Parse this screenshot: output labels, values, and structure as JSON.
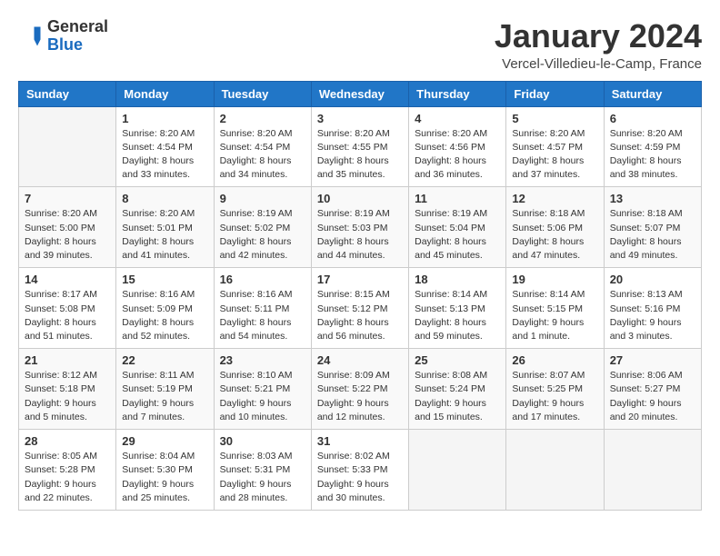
{
  "header": {
    "logo_general": "General",
    "logo_blue": "Blue",
    "month_title": "January 2024",
    "location": "Vercel-Villedieu-le-Camp, France"
  },
  "days_of_week": [
    "Sunday",
    "Monday",
    "Tuesday",
    "Wednesday",
    "Thursday",
    "Friday",
    "Saturday"
  ],
  "weeks": [
    [
      {
        "day": "",
        "detail": ""
      },
      {
        "day": "1",
        "detail": "Sunrise: 8:20 AM\nSunset: 4:54 PM\nDaylight: 8 hours\nand 33 minutes."
      },
      {
        "day": "2",
        "detail": "Sunrise: 8:20 AM\nSunset: 4:54 PM\nDaylight: 8 hours\nand 34 minutes."
      },
      {
        "day": "3",
        "detail": "Sunrise: 8:20 AM\nSunset: 4:55 PM\nDaylight: 8 hours\nand 35 minutes."
      },
      {
        "day": "4",
        "detail": "Sunrise: 8:20 AM\nSunset: 4:56 PM\nDaylight: 8 hours\nand 36 minutes."
      },
      {
        "day": "5",
        "detail": "Sunrise: 8:20 AM\nSunset: 4:57 PM\nDaylight: 8 hours\nand 37 minutes."
      },
      {
        "day": "6",
        "detail": "Sunrise: 8:20 AM\nSunset: 4:59 PM\nDaylight: 8 hours\nand 38 minutes."
      }
    ],
    [
      {
        "day": "7",
        "detail": "Sunrise: 8:20 AM\nSunset: 5:00 PM\nDaylight: 8 hours\nand 39 minutes."
      },
      {
        "day": "8",
        "detail": "Sunrise: 8:20 AM\nSunset: 5:01 PM\nDaylight: 8 hours\nand 41 minutes."
      },
      {
        "day": "9",
        "detail": "Sunrise: 8:19 AM\nSunset: 5:02 PM\nDaylight: 8 hours\nand 42 minutes."
      },
      {
        "day": "10",
        "detail": "Sunrise: 8:19 AM\nSunset: 5:03 PM\nDaylight: 8 hours\nand 44 minutes."
      },
      {
        "day": "11",
        "detail": "Sunrise: 8:19 AM\nSunset: 5:04 PM\nDaylight: 8 hours\nand 45 minutes."
      },
      {
        "day": "12",
        "detail": "Sunrise: 8:18 AM\nSunset: 5:06 PM\nDaylight: 8 hours\nand 47 minutes."
      },
      {
        "day": "13",
        "detail": "Sunrise: 8:18 AM\nSunset: 5:07 PM\nDaylight: 8 hours\nand 49 minutes."
      }
    ],
    [
      {
        "day": "14",
        "detail": "Sunrise: 8:17 AM\nSunset: 5:08 PM\nDaylight: 8 hours\nand 51 minutes."
      },
      {
        "day": "15",
        "detail": "Sunrise: 8:16 AM\nSunset: 5:09 PM\nDaylight: 8 hours\nand 52 minutes."
      },
      {
        "day": "16",
        "detail": "Sunrise: 8:16 AM\nSunset: 5:11 PM\nDaylight: 8 hours\nand 54 minutes."
      },
      {
        "day": "17",
        "detail": "Sunrise: 8:15 AM\nSunset: 5:12 PM\nDaylight: 8 hours\nand 56 minutes."
      },
      {
        "day": "18",
        "detail": "Sunrise: 8:14 AM\nSunset: 5:13 PM\nDaylight: 8 hours\nand 59 minutes."
      },
      {
        "day": "19",
        "detail": "Sunrise: 8:14 AM\nSunset: 5:15 PM\nDaylight: 9 hours\nand 1 minute."
      },
      {
        "day": "20",
        "detail": "Sunrise: 8:13 AM\nSunset: 5:16 PM\nDaylight: 9 hours\nand 3 minutes."
      }
    ],
    [
      {
        "day": "21",
        "detail": "Sunrise: 8:12 AM\nSunset: 5:18 PM\nDaylight: 9 hours\nand 5 minutes."
      },
      {
        "day": "22",
        "detail": "Sunrise: 8:11 AM\nSunset: 5:19 PM\nDaylight: 9 hours\nand 7 minutes."
      },
      {
        "day": "23",
        "detail": "Sunrise: 8:10 AM\nSunset: 5:21 PM\nDaylight: 9 hours\nand 10 minutes."
      },
      {
        "day": "24",
        "detail": "Sunrise: 8:09 AM\nSunset: 5:22 PM\nDaylight: 9 hours\nand 12 minutes."
      },
      {
        "day": "25",
        "detail": "Sunrise: 8:08 AM\nSunset: 5:24 PM\nDaylight: 9 hours\nand 15 minutes."
      },
      {
        "day": "26",
        "detail": "Sunrise: 8:07 AM\nSunset: 5:25 PM\nDaylight: 9 hours\nand 17 minutes."
      },
      {
        "day": "27",
        "detail": "Sunrise: 8:06 AM\nSunset: 5:27 PM\nDaylight: 9 hours\nand 20 minutes."
      }
    ],
    [
      {
        "day": "28",
        "detail": "Sunrise: 8:05 AM\nSunset: 5:28 PM\nDaylight: 9 hours\nand 22 minutes."
      },
      {
        "day": "29",
        "detail": "Sunrise: 8:04 AM\nSunset: 5:30 PM\nDaylight: 9 hours\nand 25 minutes."
      },
      {
        "day": "30",
        "detail": "Sunrise: 8:03 AM\nSunset: 5:31 PM\nDaylight: 9 hours\nand 28 minutes."
      },
      {
        "day": "31",
        "detail": "Sunrise: 8:02 AM\nSunset: 5:33 PM\nDaylight: 9 hours\nand 30 minutes."
      },
      {
        "day": "",
        "detail": ""
      },
      {
        "day": "",
        "detail": ""
      },
      {
        "day": "",
        "detail": ""
      }
    ]
  ]
}
